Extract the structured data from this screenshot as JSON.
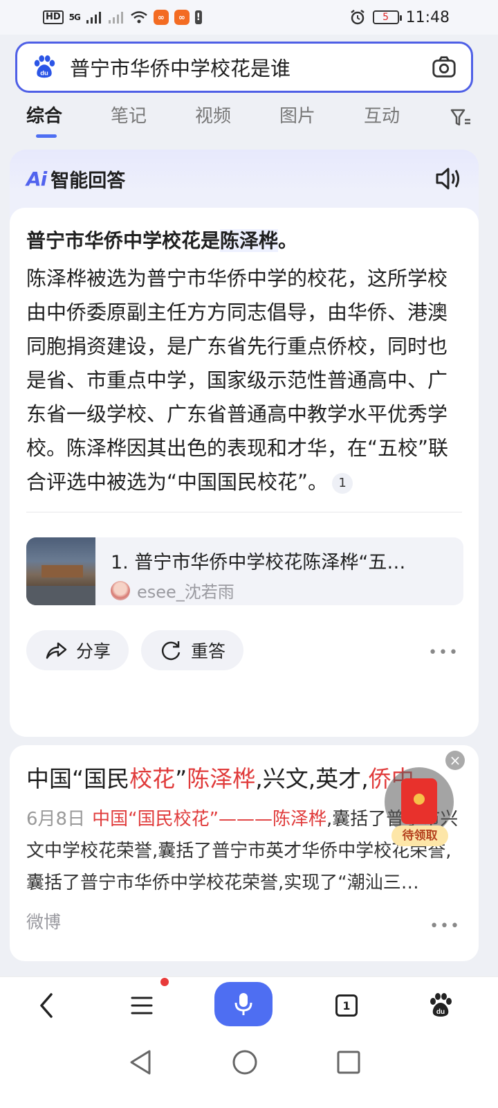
{
  "status_bar": {
    "network": "HD",
    "signal": "5G",
    "battery": "5",
    "time": "11:48"
  },
  "search": {
    "query": "普宁市华侨中学校花是谁"
  },
  "tabs": [
    "综合",
    "笔记",
    "视频",
    "图片",
    "互动"
  ],
  "ai_card": {
    "badge": "Ai",
    "title": "智能回答",
    "answer_title_prefix": "普宁市华侨中学校花是",
    "answer_title_name": "陈泽桦",
    "answer_title_suffix": "。",
    "answer_text": "陈泽桦被选为普宁市华侨中学的校花，这所学校由中侨委原副主任方方同志倡导，由华侨、港澳同胞捐资建设，是广东省先行重点侨校，同时也是省、市重点中学，国家级示范性普通高中、广东省一级学校、广东省普通高中教学水平优秀学校。陈泽桦因其出色的表现和才华，在“五校”联合评选中被选为“中国国民校花”。",
    "citation": "1",
    "source_title": "1. 普宁市华侨中学校花陈泽桦“五…",
    "source_author": "esee_沈若雨",
    "share_label": "分享",
    "regen_label": "重答",
    "more": "•••"
  },
  "result": {
    "title_1": "中国“国民",
    "title_2": "校花",
    "title_3": "”",
    "title_4": "陈泽桦",
    "title_5": ",兴文,英才,",
    "title_6": "侨中",
    "date": "6月8日",
    "snippet_red": "中国“国民校花”———陈泽桦",
    "snippet": ",囊括了普宁市兴文中学校花荣誉,囊括了普宁市英才华侨中学校花荣誉,囊括了普宁市华侨中学校花荣誉,实现了“潮汕三…",
    "source": "微博",
    "more": "•••"
  },
  "float": {
    "label": "待领取",
    "close": "×"
  },
  "toolbar": {
    "tab_count": "1"
  },
  "colors": {
    "accent": "#4e6ef2",
    "highlight": "#e03b3b"
  }
}
